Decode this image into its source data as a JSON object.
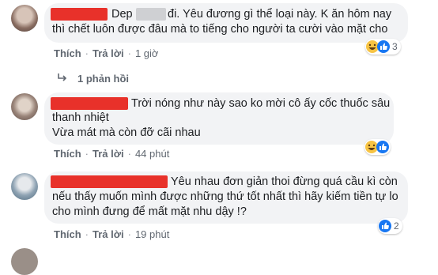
{
  "comments": [
    {
      "text_lines": [
        "Dep",
        "đi. Yêu đương gì thể loại này. K ăn hôm nay",
        "thì chết luôn được đâu mà to tiếng cho người ta cười vào mặt cho"
      ],
      "like": "Thích",
      "reply": "Trả lời",
      "time": "1 giờ",
      "reaction_count": "3",
      "reactions": [
        "haha-icon",
        "like-icon"
      ]
    },
    {
      "text_lines": [
        "Trời nóng như này sao ko mời cô ấy cốc thuốc sâu",
        "thanh nhiệt",
        "Vừa mát mà còn đỡ cãi nhau"
      ],
      "like": "Thích",
      "reply": "Trả lời",
      "time": "44 phút",
      "reaction_count": "",
      "reactions": [
        "haha-icon",
        "like-icon"
      ]
    },
    {
      "text_lines": [
        "Yêu nhau đơn giản thoi đừng quá cầu kì còn",
        "nếu thấy muốn mình được những thứ tốt nhất thì hãy kiếm tiền tự lo",
        "cho mình đưng để mất mặt nhu dậy !?"
      ],
      "like": "Thích",
      "reply": "Trả lời",
      "time": "19 phút",
      "reaction_count": "2",
      "reactions": [
        "like-icon"
      ]
    }
  ],
  "replies_link": "1 phản hồi",
  "colors": {
    "redaction": "#e8312a",
    "bubble": "#f2f3f5",
    "like_blue": "#1877f2",
    "haha_yellow": "#f7c444"
  }
}
